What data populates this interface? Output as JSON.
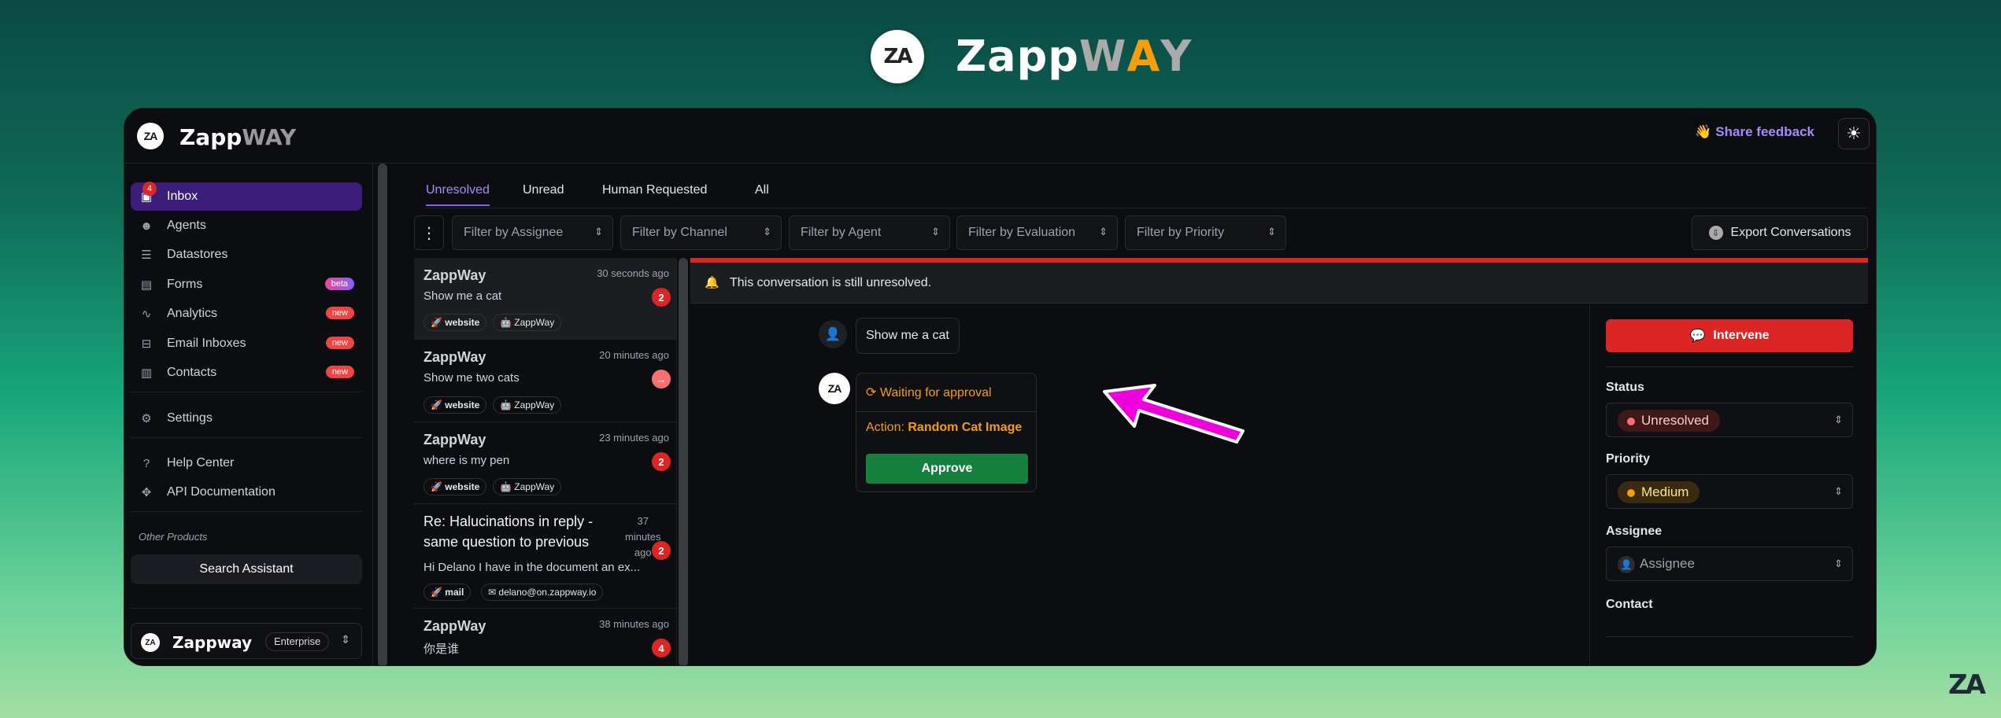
{
  "branding": {
    "name": "Zappway",
    "logo_text": "ZA",
    "colors": {
      "accent": "#8b5cf6",
      "danger": "#dc2626",
      "success": "#15803d",
      "warning": "#f59e0b"
    }
  },
  "header": {
    "share_feedback": "👋 Share feedback",
    "theme_icon": "sun-icon"
  },
  "sidebar": {
    "inbox_badge": "4",
    "items": [
      {
        "label": "Inbox",
        "icon": "inbox-icon"
      },
      {
        "label": "Agents",
        "icon": "robot-icon"
      },
      {
        "label": "Datastores",
        "icon": "database-icon"
      },
      {
        "label": "Forms",
        "icon": "form-icon",
        "pill": "beta"
      },
      {
        "label": "Analytics",
        "icon": "chart-icon",
        "pill": "new"
      },
      {
        "label": "Email Inboxes",
        "icon": "mailbox-icon",
        "pill": "new"
      },
      {
        "label": "Contacts",
        "icon": "contacts-icon",
        "pill": "new"
      },
      {
        "label": "Settings",
        "icon": "settings-icon"
      },
      {
        "label": "Help Center",
        "icon": "help-icon"
      },
      {
        "label": "API Documentation",
        "icon": "api-icon"
      }
    ],
    "other_products": "Other Products",
    "search_assistant": "Search Assistant",
    "org": {
      "name": "Zappway",
      "plan": "Enterprise"
    }
  },
  "tabs": [
    "Unresolved",
    "Unread",
    "Human Requested",
    "All"
  ],
  "filters": [
    "Filter by Assignee",
    "Filter by Channel",
    "Filter by Agent",
    "Filter by Evaluation",
    "Filter by Priority"
  ],
  "export_label": "Export Conversations",
  "conversations": [
    {
      "title": "ZappWay",
      "time": "30 seconds ago",
      "message": "Show me a cat",
      "badge": "2",
      "chips": [
        "website",
        "ZappWay"
      ]
    },
    {
      "title": "ZappWay",
      "time": "20 minutes ago",
      "message": "Show me two cats",
      "badge": "→",
      "chips": [
        "website",
        "ZappWay"
      ]
    },
    {
      "title": "ZappWay",
      "time": "23 minutes ago",
      "message": "where is my pen",
      "badge": "2",
      "chips": [
        "website",
        "ZappWay"
      ]
    },
    {
      "title_line1": "Re: Halucinations in reply -",
      "title_line2": "same question to previous",
      "time_l1": "37",
      "time_l2": "minutes",
      "time_l3": "ago",
      "message": "Hi  Delano  I have in the document an ex...",
      "badge": "2",
      "chips": [
        "mail",
        "delano@on.zappway.io"
      ]
    },
    {
      "title": "ZappWay",
      "time": "38 minutes ago",
      "message": "你是谁",
      "badge": "4"
    }
  ],
  "conversation": {
    "banner": "This conversation is still unresolved.",
    "user_message": "Show me a cat",
    "approval_status": "Waiting for approval",
    "action_prefix": "Action: ",
    "action_name": "Random Cat Image",
    "approve_label": "Approve"
  },
  "details": {
    "intervene": "Intervene",
    "status_label": "Status",
    "status_value": "Unresolved",
    "priority_label": "Priority",
    "priority_value": "Medium",
    "assignee_label": "Assignee",
    "assignee_placeholder": "Assignee",
    "contact_label": "Contact"
  }
}
